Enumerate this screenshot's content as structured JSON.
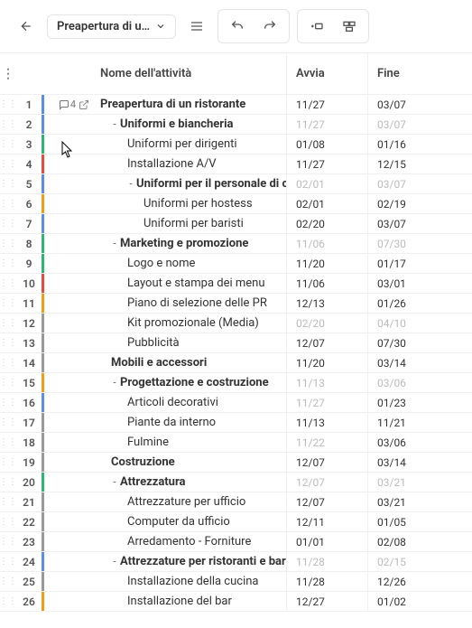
{
  "toolbar": {
    "title": "Preapertura di u…"
  },
  "headers": {
    "name": "Nome dell'attività",
    "start": "Avvia",
    "end": "Fine"
  },
  "comment_count": "4",
  "rows": [
    {
      "n": 1,
      "bar": "#5b8def",
      "name": "Preapertura di un ristorante",
      "start": "11/27",
      "end": "03/07",
      "indent": 0,
      "bold": true,
      "hasComment": true,
      "hasLink": true
    },
    {
      "n": 2,
      "bar": "#5b8def",
      "name": "Uniformi e biancheria",
      "start": "11/27",
      "end": "03/07",
      "indent": 1,
      "bold": true,
      "dim": true,
      "caret": true
    },
    {
      "n": 3,
      "bar": "#2bb673",
      "name": "Uniformi per dirigenti",
      "start": "01/08",
      "end": "01/16",
      "indent": 2
    },
    {
      "n": 4,
      "bar": "#e74c3c",
      "name": "Installazione A/V",
      "start": "11/27",
      "end": "12/15",
      "indent": 2
    },
    {
      "n": 5,
      "bar": "#5b8def",
      "name": "Uniformi per il personale di cucina",
      "start": "02/01",
      "end": "03/07",
      "indent": 2,
      "bold": true,
      "dim": true,
      "caret": true
    },
    {
      "n": 6,
      "bar": "#f39c12",
      "name": "Uniformi per hostess",
      "start": "02/01",
      "end": "02/19",
      "indent": 3
    },
    {
      "n": 7,
      "bar": "#5b8def",
      "name": "Uniformi per baristi",
      "start": "02/20",
      "end": "03/07",
      "indent": 3
    },
    {
      "n": 8,
      "bar": "#2bb673",
      "name": "Marketing e promozione",
      "start": "11/06",
      "end": "07/30",
      "indent": 1,
      "bold": true,
      "dim": true,
      "caret": true
    },
    {
      "n": 9,
      "bar": "#2bb673",
      "name": "Logo e nome",
      "start": "11/20",
      "end": "01/17",
      "indent": 2
    },
    {
      "n": 10,
      "bar": "#e74c3c",
      "name": "Layout e stampa dei menu",
      "start": "11/06",
      "end": "03/01",
      "indent": 2
    },
    {
      "n": 11,
      "bar": "#f39c12",
      "name": "Piano di selezione delle PR",
      "start": "12/13",
      "end": "01/26",
      "indent": 2
    },
    {
      "n": 12,
      "bar": "#999999",
      "name": "Kit promozionale (Media)",
      "start": "02/20",
      "end": "04/10",
      "indent": 2,
      "dim": true
    },
    {
      "n": 13,
      "bar": "#999999",
      "name": "Pubblicità",
      "start": "12/07",
      "end": "07/30",
      "indent": 2
    },
    {
      "n": 14,
      "bar": "#999999",
      "name": "Mobili e accessori",
      "start": "11/20",
      "end": "03/14",
      "indent": 1,
      "bold": true
    },
    {
      "n": 15,
      "bar": "#f39c12",
      "name": "Progettazione e costruzione",
      "start": "11/13",
      "end": "03/06",
      "indent": 1,
      "bold": true,
      "dim": true,
      "caret": true
    },
    {
      "n": 16,
      "bar": "#5b8def",
      "name": "Articoli decorativi",
      "start": "11/27",
      "end": "01/23",
      "indent": 2,
      "dimStart": true
    },
    {
      "n": 17,
      "bar": "#999999",
      "name": "Piante da interno",
      "start": "11/13",
      "end": "11/21",
      "indent": 2
    },
    {
      "n": 18,
      "bar": "#999999",
      "name": "Fulmine",
      "start": "11/22",
      "end": "03/06",
      "indent": 2,
      "dimStart": true
    },
    {
      "n": 19,
      "bar": "#999999",
      "name": "Costruzione",
      "start": "12/07",
      "end": "03/14",
      "indent": 1,
      "bold": true
    },
    {
      "n": 20,
      "bar": "#2bb673",
      "name": "Attrezzatura",
      "start": "12/07",
      "end": "03/21",
      "indent": 1,
      "bold": true,
      "dim": true,
      "caret": true
    },
    {
      "n": 21,
      "bar": "#999999",
      "name": "Attrezzature per ufficio",
      "start": "12/07",
      "end": "03/21",
      "indent": 2
    },
    {
      "n": 22,
      "bar": "#999999",
      "name": "Computer da ufficio",
      "start": "12/11",
      "end": "01/05",
      "indent": 2
    },
    {
      "n": 23,
      "bar": "#999999",
      "name": "Arredamento - Forniture",
      "start": "01/01",
      "end": "02/08",
      "indent": 2
    },
    {
      "n": 24,
      "bar": "#5b8def",
      "name": "Attrezzature per ristoranti e bar",
      "start": "11/28",
      "end": "02/15",
      "indent": 1,
      "bold": true,
      "dim": true,
      "caret": true
    },
    {
      "n": 25,
      "bar": "#999999",
      "name": "Installazione della cucina",
      "start": "11/28",
      "end": "12/26",
      "indent": 2
    },
    {
      "n": 26,
      "bar": "#f39c12",
      "name": "Installazione del bar",
      "start": "12/27",
      "end": "01/02",
      "indent": 2
    }
  ]
}
